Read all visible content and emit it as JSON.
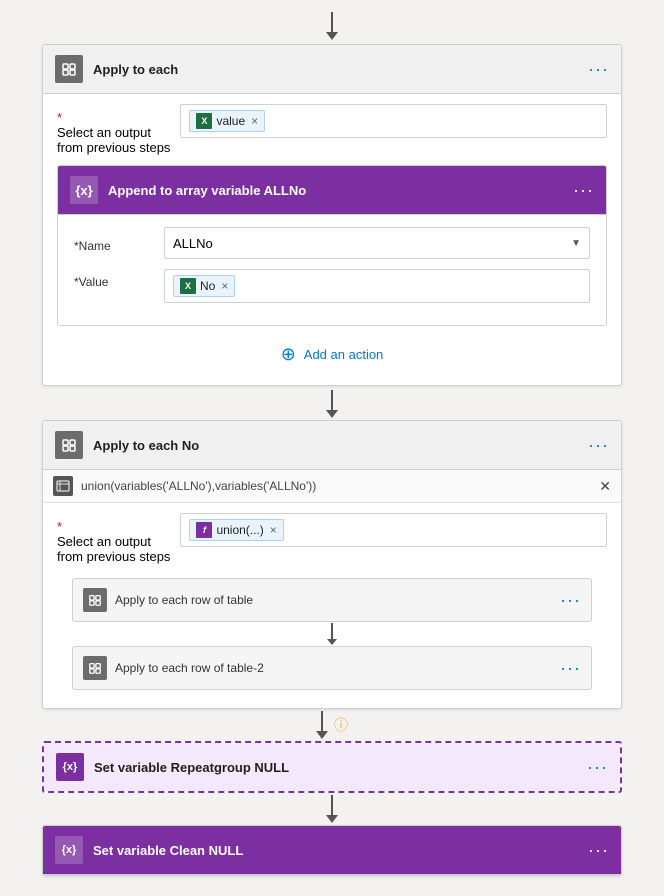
{
  "top_arrow": true,
  "apply_each_1": {
    "title": "Apply to each",
    "select_label": "* Select an output\nfrom previous steps",
    "token": "value",
    "token_type": "excel"
  },
  "append_array": {
    "title": "Append to array variable ALLNo",
    "name_label": "*Name",
    "name_value": "ALLNo",
    "value_label": "*Value",
    "value_token": "No",
    "value_token_type": "excel"
  },
  "add_action": {
    "label": "Add an action",
    "icon": "⊕"
  },
  "connector_1": true,
  "apply_each_no": {
    "title": "Apply to each No",
    "formula": "union(variables('ALLNo'),variables('ALLNo'))",
    "select_label": "* Select an output\nfrom previous steps",
    "token": "union(...)",
    "token_type": "fx",
    "inner_blocks": [
      {
        "title": "Apply to each row of table",
        "type": "loop"
      },
      {
        "title": "Apply to each row of table-2",
        "type": "loop"
      }
    ],
    "set_var_1": {
      "title": "Set variable Repeatgroup NULL",
      "dashed": true
    },
    "set_var_2": {
      "title": "Set variable Clean NULL",
      "dashed": false
    }
  },
  "colors": {
    "purple": "#7B2FA0",
    "blue": "#0078d4",
    "excel_green": "#1d6f42",
    "gray_header": "#f0f0f0",
    "border": "#d0d0d0"
  }
}
